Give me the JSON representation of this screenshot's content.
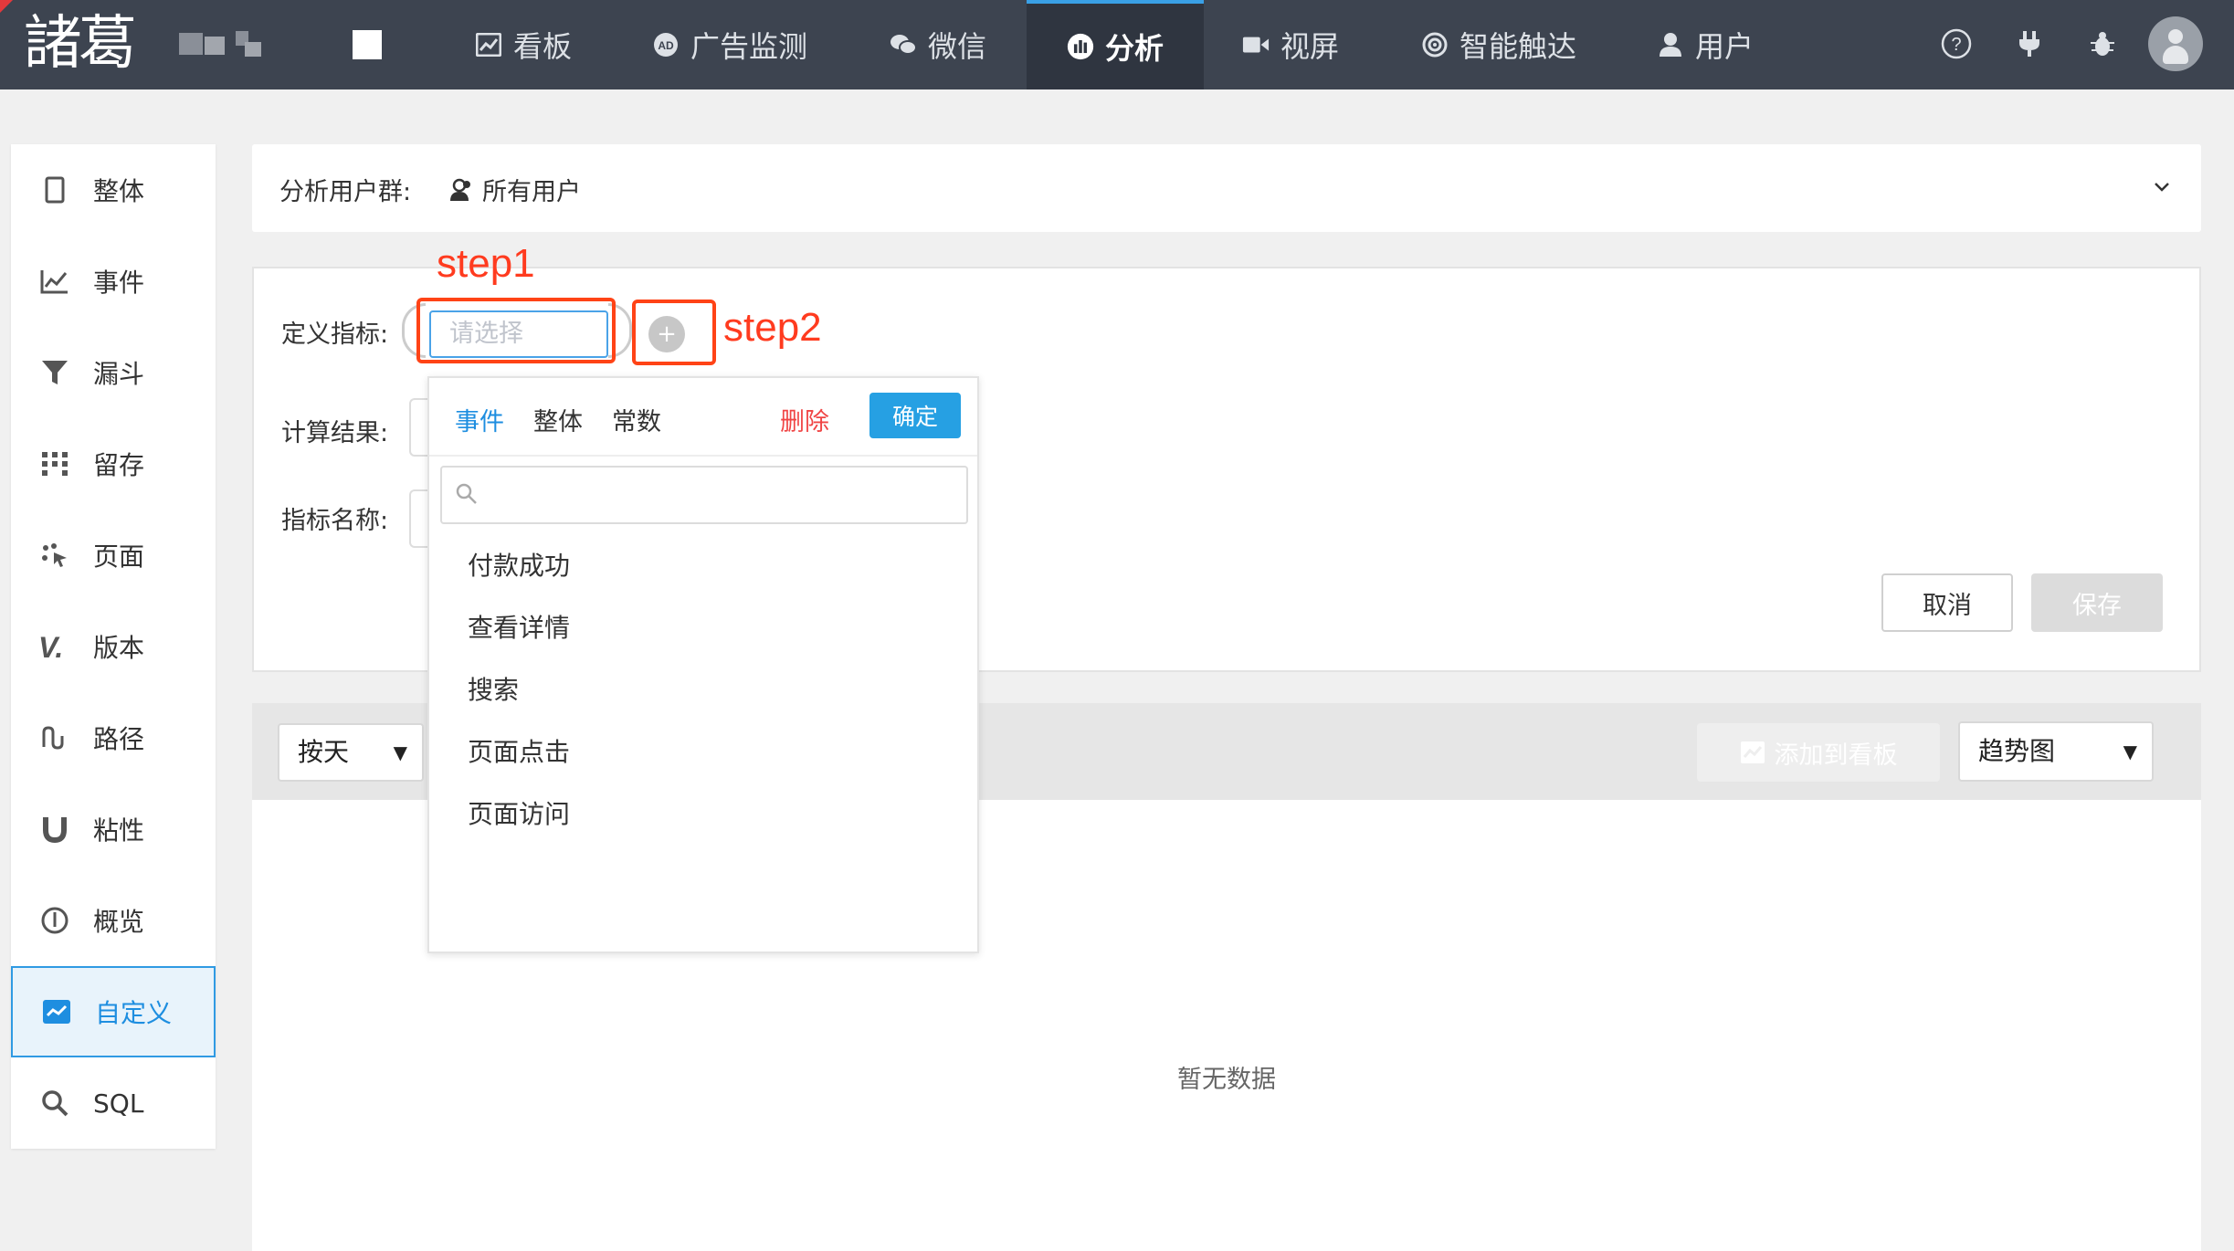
{
  "app": {
    "logo_text": "諸葛"
  },
  "topnav": {
    "items": [
      {
        "label": "看板",
        "icon": "dashboard-icon"
      },
      {
        "label": "广告监测",
        "icon": "ad-icon"
      },
      {
        "label": "微信",
        "icon": "wechat-icon"
      },
      {
        "label": "分析",
        "icon": "analysis-icon",
        "active": true
      },
      {
        "label": "视屏",
        "icon": "video-icon"
      },
      {
        "label": "智能触达",
        "icon": "target-icon"
      },
      {
        "label": "用户",
        "icon": "user-icon"
      }
    ],
    "right_icons": [
      "help-icon",
      "plugin-icon",
      "bug-icon",
      "avatar"
    ]
  },
  "sidebar": {
    "items": [
      {
        "label": "整体",
        "icon": "phone-icon"
      },
      {
        "label": "事件",
        "icon": "line-chart-icon"
      },
      {
        "label": "漏斗",
        "icon": "funnel-icon"
      },
      {
        "label": "留存",
        "icon": "grid-icon"
      },
      {
        "label": "页面",
        "icon": "page-icon"
      },
      {
        "label": "版本",
        "icon": "version-icon"
      },
      {
        "label": "路径",
        "icon": "path-icon"
      },
      {
        "label": "粘性",
        "icon": "magnet-icon"
      },
      {
        "label": "概览",
        "icon": "overview-icon"
      },
      {
        "label": "自定义",
        "icon": "custom-icon",
        "active": true
      },
      {
        "label": "SQL",
        "icon": "search-icon"
      }
    ]
  },
  "user_group": {
    "label": "分析用户群:",
    "value": "所有用户"
  },
  "form": {
    "metric_label": "定义指标:",
    "result_label": "计算结果:",
    "name_label": "指标名称:",
    "select_placeholder": "请选择",
    "plus": "+"
  },
  "annotations": {
    "step1": "step1",
    "step2": "step2"
  },
  "buttons": {
    "cancel": "取消",
    "save": "保存"
  },
  "dropdown": {
    "tabs": [
      "事件",
      "整体",
      "常数"
    ],
    "delete": "删除",
    "ok": "确定",
    "search_placeholder": "",
    "items": [
      "付款成功",
      "查看详情",
      "搜索",
      "页面点击",
      "页面访问"
    ]
  },
  "result": {
    "granularity": "按天",
    "add_to_board": "添加到看板",
    "chart_type": "趋势图",
    "empty_text": "暂无数据"
  },
  "colors": {
    "nav_bg": "#3d4450",
    "accent": "#26a0e3",
    "annotation": "#ff3b1f",
    "delete": "#f04545"
  }
}
